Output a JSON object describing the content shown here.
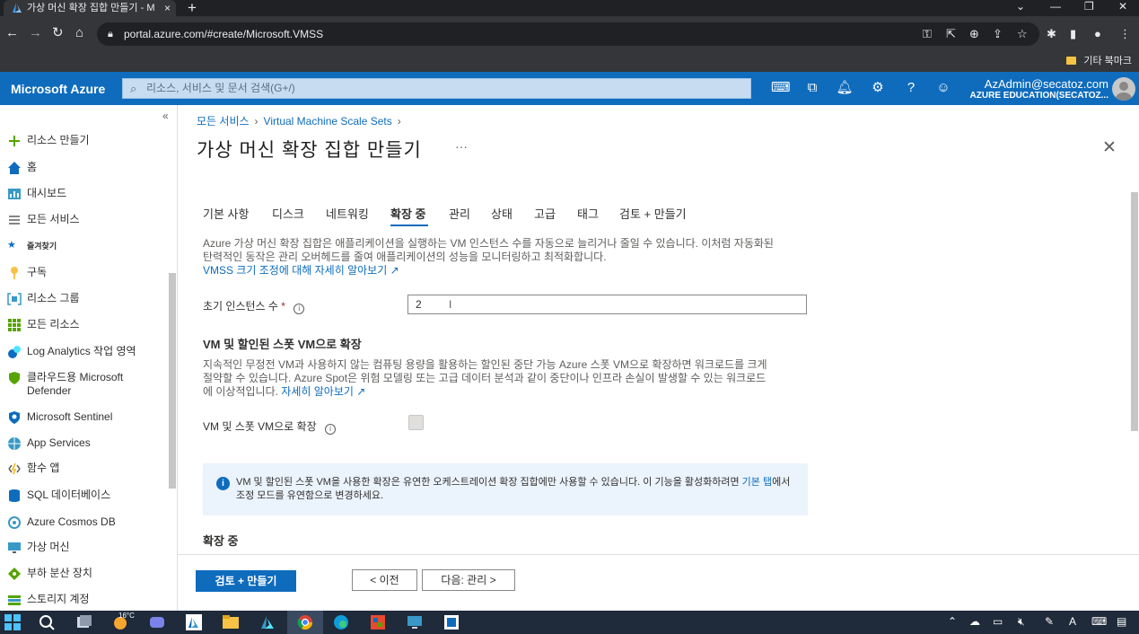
{
  "browser": {
    "tab_title": "가상 머신 확장 집합 만들기 - M",
    "tab_close": "×",
    "new_tab": "+",
    "url": "portal.azure.com/#create/Microsoft.VMSS",
    "bookmark_folder": "기타 북마크"
  },
  "azure": {
    "brand": "Microsoft Azure",
    "search_placeholder": "리소스, 서비스 및 문서 검색(G+/)",
    "account_user": "AzAdmin@secatoz.com",
    "account_tenant": "AZURE EDUCATION(SECATOZ...",
    "colors": {
      "header": "#0f6cbd",
      "accent": "#0f6cbd"
    }
  },
  "sidebar": {
    "items": [
      {
        "label": "리소스 만들기",
        "icon": "plus-icon"
      },
      {
        "label": "홈",
        "icon": "home-icon"
      },
      {
        "label": "대시보드",
        "icon": "dashboard-icon"
      },
      {
        "label": "모든 서비스",
        "icon": "list-icon"
      },
      {
        "label": "즐겨찾기",
        "icon": "star-icon"
      },
      {
        "label": "구독",
        "icon": "key-icon"
      },
      {
        "label": "리소스 그룹",
        "icon": "resource-group-icon"
      },
      {
        "label": "모든 리소스",
        "icon": "grid-icon"
      },
      {
        "label": "Log Analytics 작업 영역",
        "icon": "log-analytics-icon"
      },
      {
        "label": "클라우드용 Microsoft Defender",
        "icon": "shield-icon"
      },
      {
        "label": "Microsoft Sentinel",
        "icon": "sentinel-icon"
      },
      {
        "label": "App Services",
        "icon": "globe-icon"
      },
      {
        "label": "함수 앱",
        "icon": "function-icon"
      },
      {
        "label": "SQL 데이터베이스",
        "icon": "sql-icon"
      },
      {
        "label": "Azure Cosmos DB",
        "icon": "cosmos-icon"
      },
      {
        "label": "가상 머신",
        "icon": "monitor-icon"
      },
      {
        "label": "부하 분산 장치",
        "icon": "load-balancer-icon"
      },
      {
        "label": "스토리지 계정",
        "icon": "storage-icon"
      }
    ],
    "collapse": "«"
  },
  "blade": {
    "breadcrumb": [
      "모든 서비스",
      "Virtual Machine Scale Sets"
    ],
    "title": "가상 머신 확장 집합 만들기",
    "more": "···",
    "tabs": [
      "기본 사항",
      "디스크",
      "네트워킹",
      "확장 중",
      "관리",
      "상태",
      "고급",
      "태그",
      "검토 + 만들기"
    ],
    "active_tab": "확장 중",
    "intro_line1": "Azure 가상 머신 확장 집합은 애플리케이션을 실행하는 VM 인스턴스 수를 자동으로 늘리거나 줄일 수 있습니다. 이처럼 자동화된",
    "intro_line2": "탄력적인 동작은 관리 오버헤드를 줄여 애플리케이션의 성능을 모니터링하고 최적화합니다.",
    "intro_link": "VMSS 크기 조정에 대해 자세히 알아보기",
    "instance_label": "초기 인스턴스 수",
    "required_mark": "*",
    "instance_value": "2",
    "spot_heading": "VM 및 할인된 스폿 VM으로 확장",
    "spot_line1": "지속적인 무정전 VM과 사용하지 않는 컴퓨팅 용량을 활용하는 할인된 중단 가능 Azure 스폿 VM으로 확장하면 워크로드를 크게",
    "spot_line2": "절약할 수 있습니다. Azure Spot은 위험 모델링 또는 고급 데이터 분석과 같이 중단이나 인프라 손실이 발생할 수 있는 워크로드",
    "spot_line3": "에 이상적입니다.",
    "spot_link": "자세히 알아보기",
    "spot_checkbox_label": "VM 및 스폿 VM으로 확장",
    "spot_checked": false,
    "info_text": "VM 및 할인된 스폿 VM을 사용한 확장은 유연한 오케스트레이션 확장 집합에만 사용할 수 있습니다. 이 기능을 활성화하려면",
    "info_link": "기본 탭",
    "info_text2": "에서 조정 모드를 유연함으로 변경하세요.",
    "scaling_heading": "확장 중"
  },
  "footer": {
    "review_button": "검토 + 만들기",
    "prev_button": "< 이전",
    "next_button": "다음: 관리 >"
  },
  "taskbar": {
    "weather": "16°C"
  }
}
